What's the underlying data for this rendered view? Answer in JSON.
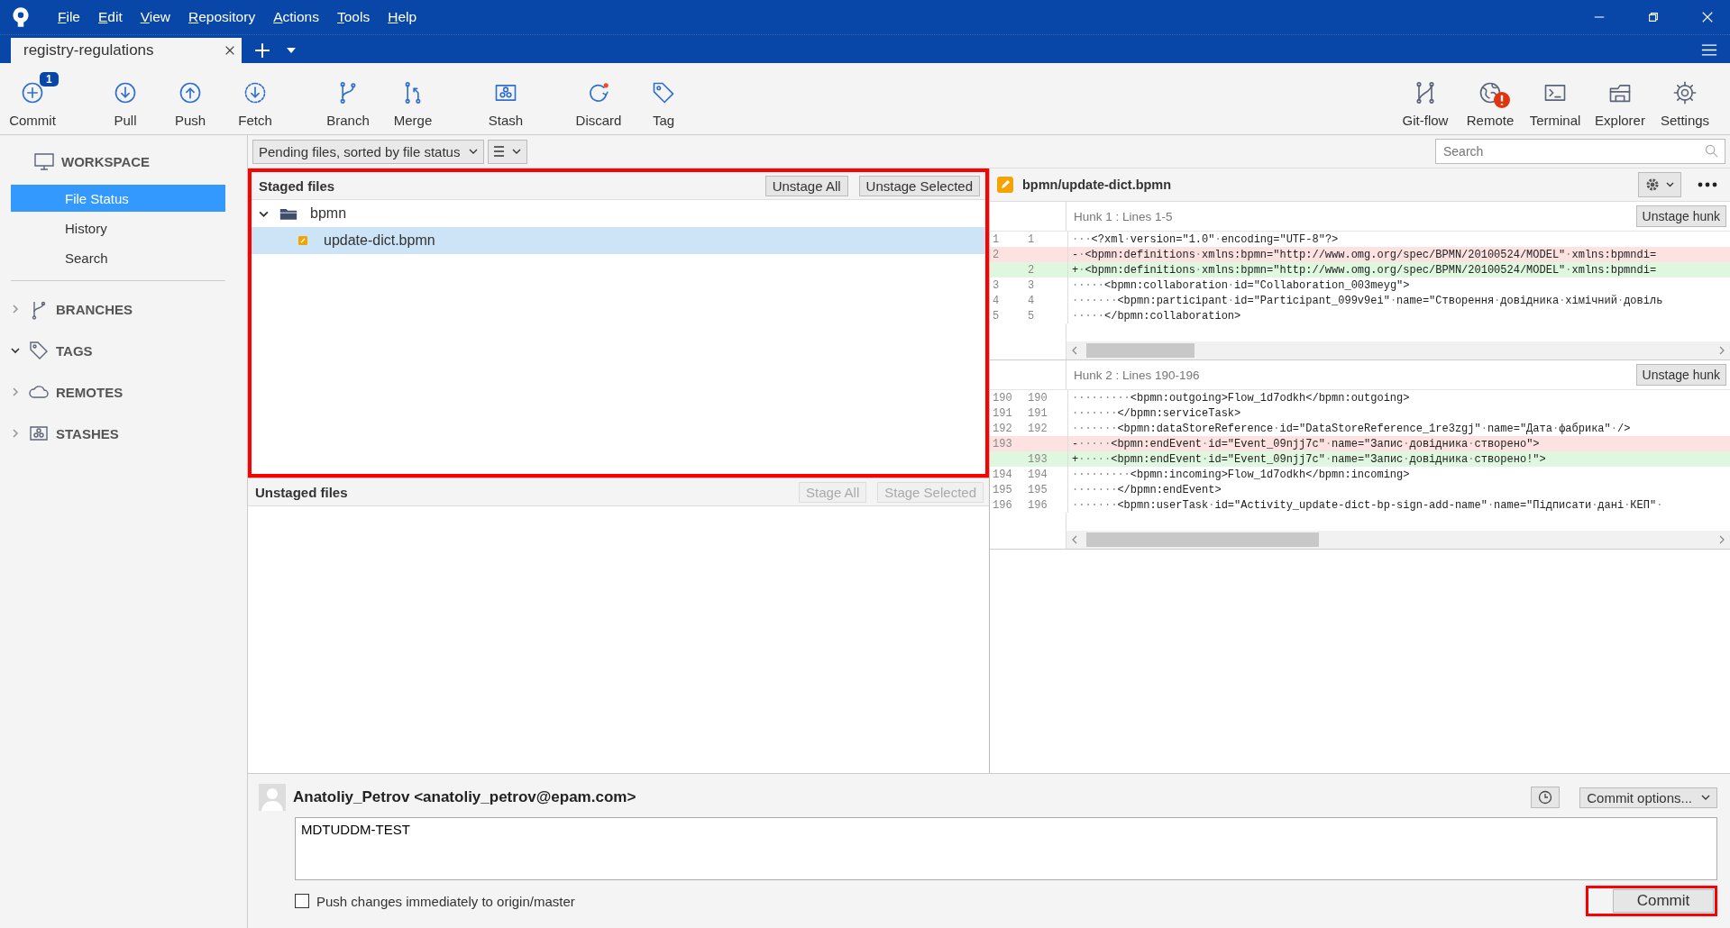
{
  "menu": [
    "File",
    "Edit",
    "View",
    "Repository",
    "Actions",
    "Tools",
    "Help"
  ],
  "tabs": [
    {
      "label": "registry-regulations",
      "selected": true
    }
  ],
  "toolbar": {
    "left": [
      {
        "label": "Commit",
        "badge": "1"
      },
      {
        "label": "Pull"
      },
      {
        "label": "Push"
      },
      {
        "label": "Fetch"
      },
      {
        "label": "Branch"
      },
      {
        "label": "Merge"
      },
      {
        "label": "Stash"
      },
      {
        "label": "Discard"
      },
      {
        "label": "Tag"
      }
    ],
    "right": [
      {
        "label": "Git-flow",
        "alert": false
      },
      {
        "label": "Remote",
        "alert": true
      },
      {
        "label": "Terminal",
        "alert": false
      },
      {
        "label": "Explorer",
        "alert": false
      },
      {
        "label": "Settings",
        "alert": false
      }
    ]
  },
  "sidebar": {
    "workspace": {
      "title": "WORKSPACE",
      "items": [
        {
          "label": "File Status",
          "selected": true
        },
        {
          "label": "History",
          "selected": false
        },
        {
          "label": "Search",
          "selected": false
        }
      ]
    },
    "sections": [
      {
        "title": "BRANCHES",
        "expanded": false
      },
      {
        "title": "TAGS",
        "expanded": true
      },
      {
        "title": "REMOTES",
        "expanded": false
      },
      {
        "title": "STASHES",
        "expanded": false
      }
    ]
  },
  "file_filter": {
    "value": "Pending files, sorted by file status"
  },
  "search": {
    "placeholder": "Search"
  },
  "staged": {
    "title": "Staged files",
    "annotated": true,
    "buttons": [
      {
        "label": "Unstage All",
        "disabled": false
      },
      {
        "label": "Unstage Selected",
        "disabled": false
      }
    ],
    "tree": [
      {
        "name": "bpmn",
        "kind": "folder",
        "expanded": true,
        "selected": false,
        "children": [
          {
            "name": "update-dict.bpmn",
            "kind": "file",
            "selected": true
          }
        ]
      }
    ]
  },
  "unstaged": {
    "title": "Unstaged files",
    "annotated": false,
    "buttons": [
      {
        "label": "Stage All",
        "disabled": true
      },
      {
        "label": "Stage Selected",
        "disabled": true
      }
    ]
  },
  "diff": {
    "file": "bpmn/update-dict.bpmn",
    "hunks": [
      {
        "title": "Hunk 1 : Lines 1-5",
        "button": "Unstage hunk",
        "lines": [
          {
            "kind": "context",
            "old": "1",
            "new": "1",
            "text": "···<?xml·version=\"1.0\"·encoding=\"UTF-8\"?>"
          },
          {
            "kind": "removed",
            "old": "2",
            "text": "-·<bpmn:definitions·xmlns:bpmn=\"http://www.omg.org/spec/BPMN/20100524/MODEL\"·xmlns:bpmndi="
          },
          {
            "kind": "added",
            "new": "2",
            "text": "+·<bpmn:definitions·xmlns:bpmn=\"http://www.omg.org/spec/BPMN/20100524/MODEL\"·xmlns:bpmndi="
          },
          {
            "kind": "context",
            "old": "3",
            "new": "3",
            "text": "·····<bpmn:collaboration·id=\"Collaboration_003meyg\">"
          },
          {
            "kind": "context",
            "old": "4",
            "new": "4",
            "text": "·······<bpmn:participant·id=\"Participant_099v9ei\"·name=\"Створення·довідника·хімічний·довіль"
          },
          {
            "kind": "context",
            "old": "5",
            "new": "5",
            "text": "·····</bpmn:collaboration>"
          }
        ]
      },
      {
        "title": "Hunk 2 : Lines 190-196",
        "button": "Unstage hunk",
        "lines": [
          {
            "kind": "context",
            "old": "190",
            "new": "190",
            "text": "·········<bpmn:outgoing>Flow_1d7odkh</bpmn:outgoing>"
          },
          {
            "kind": "context",
            "old": "191",
            "new": "191",
            "text": "·······</bpmn:serviceTask>"
          },
          {
            "kind": "context",
            "old": "192",
            "new": "192",
            "text": "·······<bpmn:dataStoreReference·id=\"DataStoreReference_1re3zgj\"·name=\"Дата·фабрика\"·/>"
          },
          {
            "kind": "removed",
            "old": "193",
            "text": "-·····<bpmn:endEvent·id=\"Event_09njj7c\"·name=\"Запис·довідника·створено\">"
          },
          {
            "kind": "added",
            "new": "193",
            "text": "+·····<bpmn:endEvent·id=\"Event_09njj7c\"·name=\"Запис·довідника·створено!\">"
          },
          {
            "kind": "context",
            "old": "194",
            "new": "194",
            "text": "·········<bpmn:incoming>Flow_1d7odkh</bpmn:incoming>"
          },
          {
            "kind": "context",
            "old": "195",
            "new": "195",
            "text": "·······</bpmn:endEvent>"
          },
          {
            "kind": "context",
            "old": "196",
            "new": "196",
            "text": "·······<bpmn:userTask·id=\"Activity_update-dict-bp-sign-add-name\"·name=\"Підписати·дані·КЕП\"·"
          }
        ]
      }
    ]
  },
  "commit": {
    "author": "Anatoliy_Petrov <anatoliy_petrov@epam.com>",
    "message": "MDTUDDM-TEST",
    "options_button": "Commit options...",
    "push_checkbox": {
      "label": "Push changes immediately to origin/master",
      "checked": false
    },
    "commit_button": {
      "label": "Commit",
      "annotated": true
    }
  }
}
